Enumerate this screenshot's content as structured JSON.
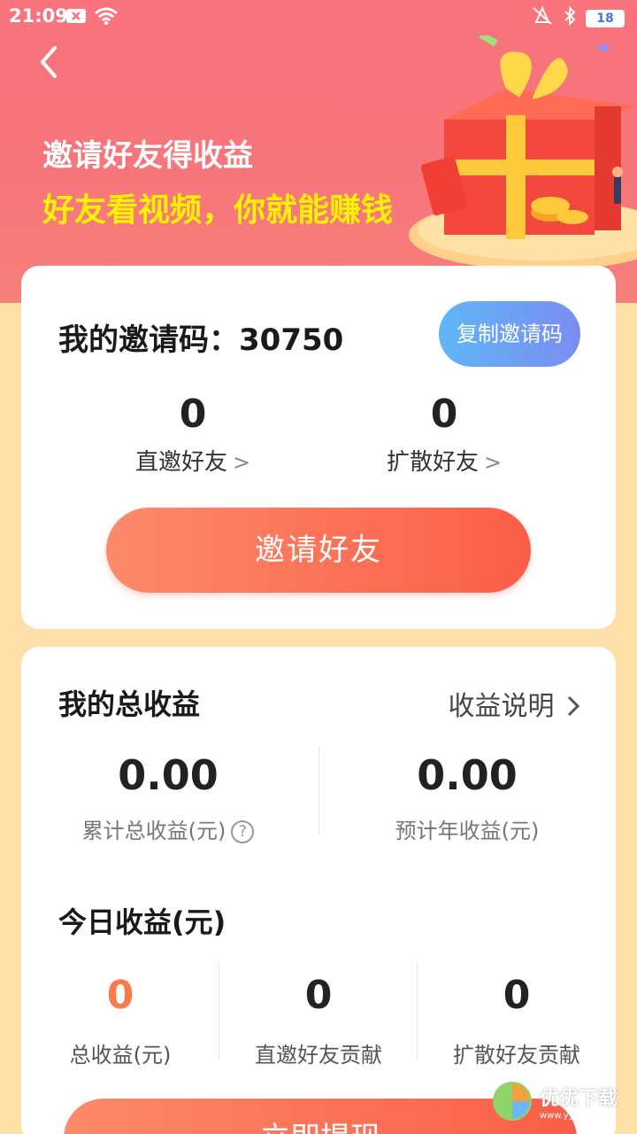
{
  "status_bar": {
    "time": "21:09",
    "battery": "18"
  },
  "hero": {
    "title": "邀请好友得收益",
    "subtitle": "好友看视频，你就能赚钱"
  },
  "invite_card": {
    "code_label": "我的邀请码：",
    "code_value": "30750",
    "copy_button": "复制邀请码",
    "direct_friends": {
      "count": "0",
      "label": "直邀好友"
    },
    "spread_friends": {
      "count": "0",
      "label": "扩散好友"
    },
    "invite_button": "邀请好友"
  },
  "earnings_card": {
    "title": "我的总收益",
    "explain_link": "收益说明",
    "total": {
      "value": "0.00",
      "label": "累计总收益(元)"
    },
    "annual": {
      "value": "0.00",
      "label": "预计年收益(元)"
    },
    "today_title": "今日收益(元)",
    "today": [
      {
        "value": "0",
        "label": "总收益(元)"
      },
      {
        "value": "0",
        "label": "直邀好友贡献"
      },
      {
        "value": "0",
        "label": "扩散好友贡献"
      }
    ],
    "withdraw_button": "立即提现"
  },
  "watermark": {
    "text": "优优下载",
    "url": "www.yyxt.com"
  },
  "colors": {
    "hero_bg": "#F9737C",
    "page_bg": "#FFE0A8",
    "accent_orange": "#FB5E48",
    "subtitle_yellow": "#FFF200",
    "copy_button_blue": "#5FB6F7"
  }
}
